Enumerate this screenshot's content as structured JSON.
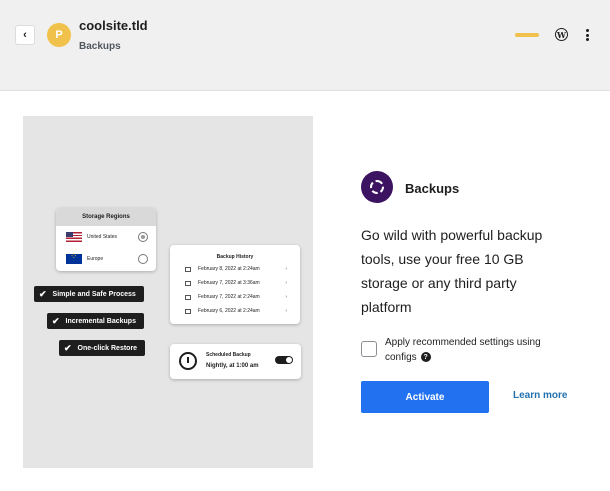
{
  "header": {
    "avatar_letter": "P",
    "site_name": "coolsite.tld",
    "section": "Backups",
    "back_icon": "chevron-left-icon",
    "status_color": "#f0c24b"
  },
  "illustration": {
    "regions_title": "Storage Regions",
    "regions": [
      {
        "label": "United States",
        "selected": true
      },
      {
        "label": "Europe",
        "selected": false
      }
    ],
    "features": [
      "Simple and Safe Process",
      "Incremental Backups",
      "One-click Restore"
    ],
    "history_title": "Backup History",
    "history": [
      "February 8, 2022 at 2:24am",
      "February 7, 2022 at 3:36am",
      "February 7, 2022 at 2:24am",
      "February 6, 2022 at 2:24am"
    ],
    "schedule_label": "Scheduled Backup",
    "schedule_value": "Nightly, at 1:00 am"
  },
  "plugin": {
    "title": "Backups",
    "description": "Go wild with powerful backup tools, use your free 10 GB storage or any third party platform",
    "checkbox_label": "Apply recommended settings using configs",
    "activate_label": "Activate",
    "learn_more_label": "Learn more",
    "accent_color": "#2271f1",
    "icon_color": "#3c1361"
  }
}
